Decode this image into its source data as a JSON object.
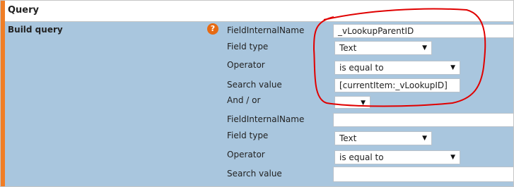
{
  "section": {
    "title": "Query"
  },
  "row": {
    "label": "Build query",
    "help_icon": "question-icon",
    "help_glyph": "?"
  },
  "rows": [
    {
      "field_name_label": "FieldInternalName",
      "field_name_value": "_vLookupParentID",
      "field_type_label": "Field type",
      "field_type_value": "Text",
      "operator_label": "Operator",
      "operator_value": "is equal to",
      "search_value_label": "Search value",
      "search_value_value": "[currentItem:_vLookupID]",
      "and_or_label": "And / or",
      "and_or_value": ""
    },
    {
      "field_name_label": "FieldInternalName",
      "field_name_value": "",
      "field_type_label": "Field type",
      "field_type_value": "Text",
      "operator_label": "Operator",
      "operator_value": "is equal to",
      "search_value_label": "Search value",
      "search_value_value": ""
    }
  ],
  "colors": {
    "accent": "#f07e26",
    "panel_bg": "#a9c6de",
    "annotation": "#e00000"
  }
}
